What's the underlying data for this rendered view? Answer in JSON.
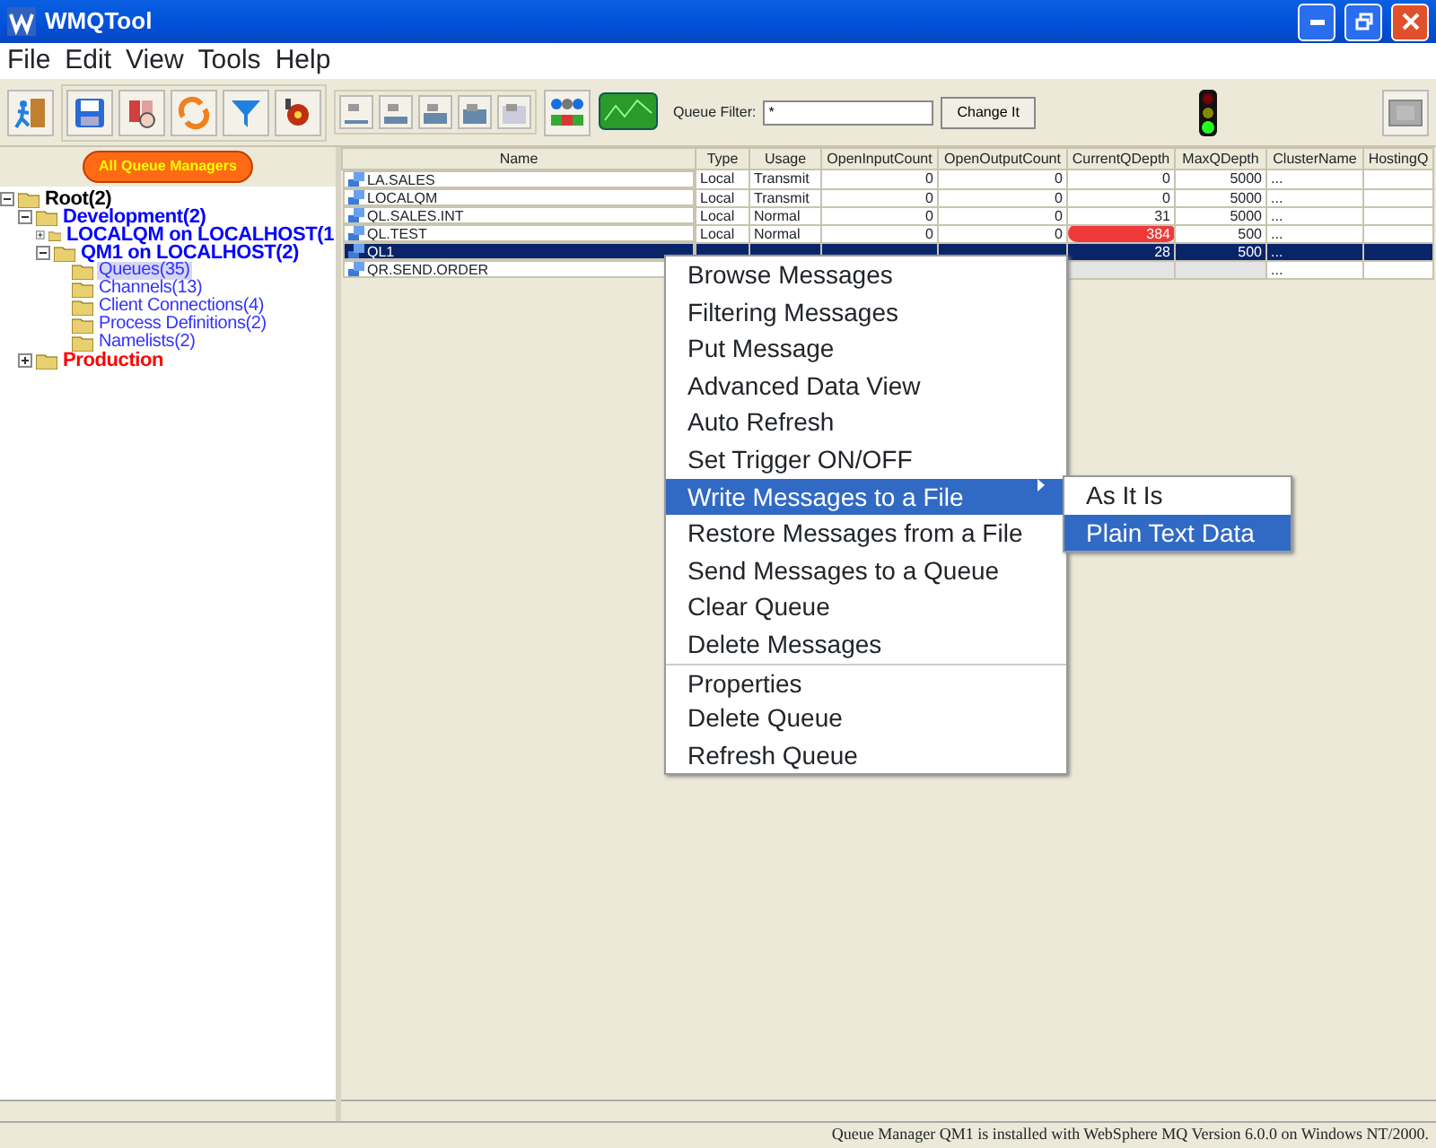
{
  "window": {
    "title": "WMQTool"
  },
  "menu_bar": [
    "File",
    "Edit",
    "View",
    "Tools",
    "Help"
  ],
  "toolbar": {
    "filter_label": "Queue Filter:",
    "filter_value": "*",
    "filter_button": "Change It"
  },
  "left_pane": {
    "button": "All Queue Managers",
    "tree": [
      {
        "label": "Root(2)",
        "color": "#000000",
        "bold": true,
        "expanded": true,
        "selected": false,
        "children": [
          {
            "label": "Development(2)",
            "color": "#0000ff",
            "bold": true,
            "expanded": true,
            "selected": false,
            "children": [
              {
                "label": "LOCALQM on LOCALHOST(1",
                "color": "#0000ff",
                "bold": true,
                "expanded": false,
                "selected": false
              },
              {
                "label": "QM1 on LOCALHOST(2)",
                "color": "#0000ff",
                "bold": true,
                "expanded": true,
                "selected": false,
                "children": [
                  {
                    "label": "Queues(35)",
                    "color": "#3333ff",
                    "bold": false,
                    "selected": true
                  },
                  {
                    "label": "Channels(13)",
                    "color": "#3333ff",
                    "bold": false,
                    "selected": false
                  },
                  {
                    "label": "Client Connections(4)",
                    "color": "#3333ff",
                    "bold": false,
                    "selected": false
                  },
                  {
                    "label": "Process Definitions(2)",
                    "color": "#3333ff",
                    "bold": false,
                    "selected": false
                  },
                  {
                    "label": "Namelists(2)",
                    "color": "#3333ff",
                    "bold": false,
                    "selected": false
                  }
                ]
              }
            ]
          },
          {
            "label": "Production",
            "color": "#ff0000",
            "bold": true,
            "expanded": false,
            "selected": false
          }
        ]
      }
    ]
  },
  "table": {
    "columns": [
      "Name",
      "Type",
      "Usage",
      "OpenInputCount",
      "OpenOutputCount",
      "CurrentQDepth",
      "MaxQDepth",
      "ClusterName",
      "HostingQ"
    ],
    "rows": [
      {
        "selected": false,
        "cells": [
          "LA.SALES",
          "Local",
          "Transmit",
          "0",
          "0",
          "0",
          "5000",
          "...",
          null
        ],
        "alert": false
      },
      {
        "selected": false,
        "cells": [
          "LOCALQM",
          "Local",
          "Transmit",
          "0",
          "0",
          "0",
          "5000",
          "...",
          null
        ],
        "alert": false
      },
      {
        "selected": false,
        "cells": [
          "QL.SALES.INT",
          "Local",
          "Normal",
          "0",
          "0",
          "31",
          "5000",
          "...",
          null
        ],
        "alert": false
      },
      {
        "selected": false,
        "cells": [
          "QL.TEST",
          "Local",
          "Normal",
          "0",
          "0",
          "384",
          "500",
          "...",
          null
        ],
        "alert": true
      },
      {
        "selected": true,
        "cells": [
          "QL1",
          null,
          null,
          null,
          null,
          "28",
          "500",
          "...",
          null
        ],
        "alert": false
      },
      {
        "selected": false,
        "cells": [
          "QR.SEND.ORDER",
          null,
          null,
          null,
          null,
          null,
          null,
          "...",
          null
        ],
        "alert": false
      }
    ]
  },
  "context_menu": {
    "groups": [
      [
        {
          "label": "Browse Messages",
          "selected": false,
          "submenu": false
        },
        {
          "label": "Filtering Messages",
          "selected": false,
          "submenu": false
        },
        {
          "label": "Put Message",
          "selected": false,
          "submenu": false
        },
        {
          "label": "Advanced Data View",
          "selected": false,
          "submenu": false
        },
        {
          "label": "Auto Refresh",
          "selected": false,
          "submenu": false
        },
        {
          "label": "Set Trigger ON/OFF",
          "selected": false,
          "submenu": false
        },
        {
          "label": "Write Messages to a File",
          "selected": true,
          "submenu": true
        },
        {
          "label": "Restore Messages from a File",
          "selected": false,
          "submenu": false
        },
        {
          "label": "Send Messages to a Queue",
          "selected": false,
          "submenu": false
        },
        {
          "label": "Clear Queue",
          "selected": false,
          "submenu": false
        },
        {
          "label": "Delete Messages",
          "selected": false,
          "submenu": false
        }
      ],
      [
        {
          "label": "Properties",
          "selected": false,
          "submenu": false
        },
        {
          "label": "Delete Queue",
          "selected": false,
          "submenu": false
        },
        {
          "label": "Refresh Queue",
          "selected": false,
          "submenu": false
        }
      ]
    ],
    "submenu": [
      {
        "label": "As It Is",
        "selected": false
      },
      {
        "label": "Plain Text Data",
        "selected": true
      }
    ]
  },
  "status_bar": "Queue Manager QM1 is installed with WebSphere MQ Version 6.0.0 on Windows NT/2000."
}
